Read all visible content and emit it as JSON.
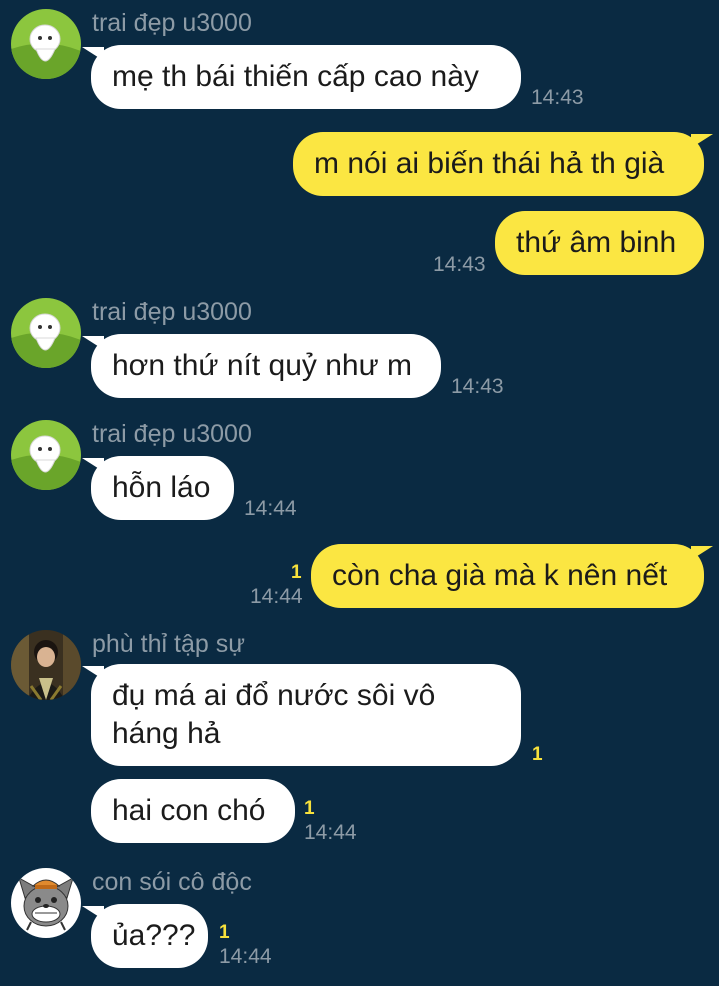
{
  "colors": {
    "background": "#0a2a42",
    "incoming_bubble": "#ffffff",
    "outgoing_bubble": "#fbe642",
    "meta_text": "#8d9ba6",
    "unread_count": "#f7e13c"
  },
  "messages": [
    {
      "sender": "trai đẹp u3000",
      "text": "mẹ th bái thiến cấp cao này",
      "time": "14:43"
    },
    {
      "text": "m nói ai biến thái hả th già"
    },
    {
      "text": "thứ âm binh",
      "time": "14:43"
    },
    {
      "sender": "trai đẹp u3000",
      "text": "hơn thứ nít quỷ như m",
      "time": "14:43"
    },
    {
      "sender": "trai đẹp u3000",
      "text": "hỗn láo",
      "time": "14:44"
    },
    {
      "text": "còn cha già mà k nên nết",
      "unread": "1",
      "time": "14:44"
    },
    {
      "sender": "phù thỉ tập sự",
      "text": "đụ má ai đổ nước sôi vô háng hả",
      "unread": "1"
    },
    {
      "text": "hai con chó",
      "unread": "1",
      "time": "14:44"
    },
    {
      "sender": "con sói cô độc",
      "text": "ủa???",
      "unread": "1",
      "time": "14:44"
    }
  ],
  "avatars": [
    "green-mascot-avatar",
    "green-mascot-avatar",
    "green-mascot-avatar",
    "photo-avatar",
    "grey-wolf-avatar"
  ]
}
